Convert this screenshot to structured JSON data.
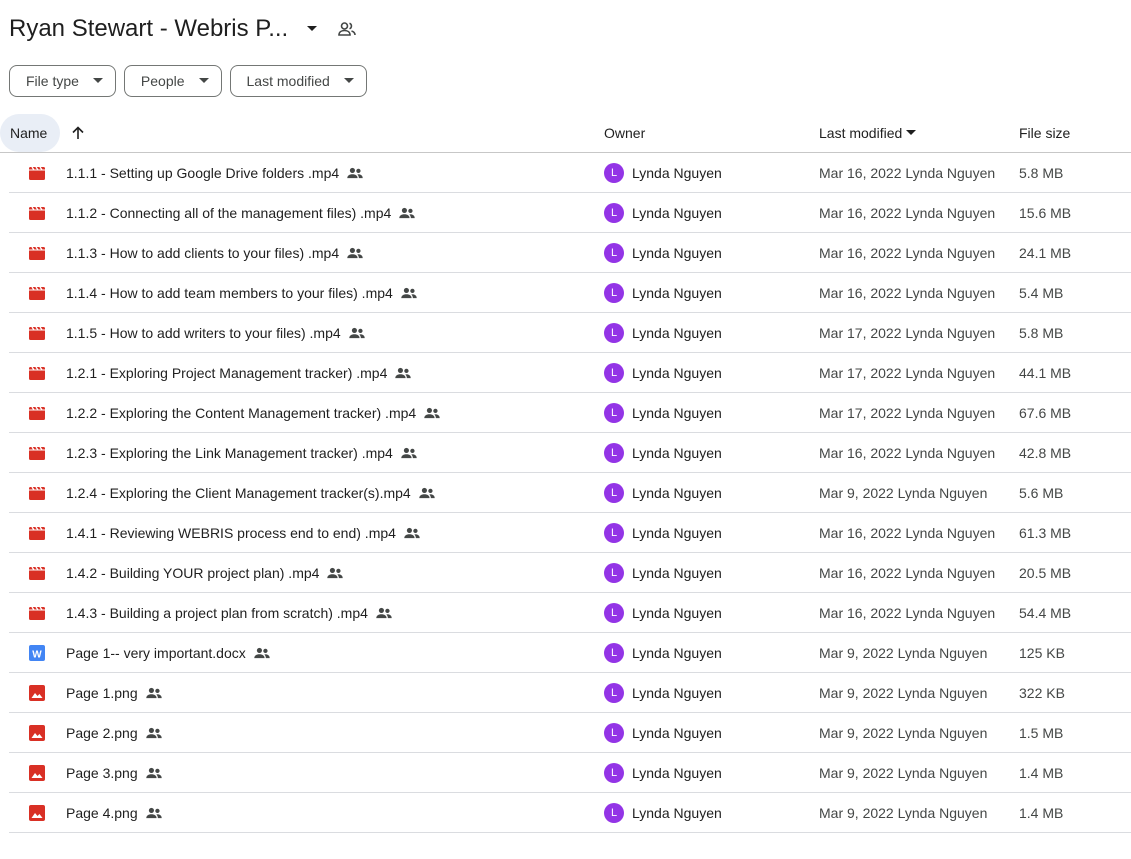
{
  "header": {
    "title": "Ryan Stewart - Webris P..."
  },
  "filters": [
    {
      "label": "File type"
    },
    {
      "label": "People"
    },
    {
      "label": "Last modified"
    }
  ],
  "columns": {
    "name": "Name",
    "owner": "Owner",
    "modified": "Last modified",
    "size": "File size"
  },
  "colors": {
    "video": "#d93025",
    "image": "#d93025",
    "doc": "#4285f4",
    "avatar": "#9334e6"
  },
  "files": [
    {
      "name": "1.1.1 - Setting up Google Drive folders .mp4",
      "type": "video",
      "owner": "Lynda Nguyen",
      "owner_initial": "L",
      "modified": "Mar 16, 2022 Lynda Nguyen",
      "size": "5.8 MB"
    },
    {
      "name": "1.1.2 - Connecting all of the management files) .mp4",
      "type": "video",
      "owner": "Lynda Nguyen",
      "owner_initial": "L",
      "modified": "Mar 16, 2022 Lynda Nguyen",
      "size": "15.6 MB"
    },
    {
      "name": "1.1.3 - How to add clients to your files) .mp4",
      "type": "video",
      "owner": "Lynda Nguyen",
      "owner_initial": "L",
      "modified": "Mar 16, 2022 Lynda Nguyen",
      "size": "24.1 MB"
    },
    {
      "name": "1.1.4 - How to add team members to your files) .mp4",
      "type": "video",
      "owner": "Lynda Nguyen",
      "owner_initial": "L",
      "modified": "Mar 16, 2022 Lynda Nguyen",
      "size": "5.4 MB"
    },
    {
      "name": "1.1.5 - How to add writers to your files) .mp4",
      "type": "video",
      "owner": "Lynda Nguyen",
      "owner_initial": "L",
      "modified": "Mar 17, 2022 Lynda Nguyen",
      "size": "5.8 MB"
    },
    {
      "name": "1.2.1 - Exploring Project Management tracker) .mp4",
      "type": "video",
      "owner": "Lynda Nguyen",
      "owner_initial": "L",
      "modified": "Mar 17, 2022 Lynda Nguyen",
      "size": "44.1 MB"
    },
    {
      "name": "1.2.2 - Exploring the Content Management tracker) .mp4",
      "type": "video",
      "owner": "Lynda Nguyen",
      "owner_initial": "L",
      "modified": "Mar 17, 2022 Lynda Nguyen",
      "size": "67.6 MB"
    },
    {
      "name": "1.2.3 - Exploring the Link Management tracker) .mp4",
      "type": "video",
      "owner": "Lynda Nguyen",
      "owner_initial": "L",
      "modified": "Mar 16, 2022 Lynda Nguyen",
      "size": "42.8 MB"
    },
    {
      "name": "1.2.4 - Exploring the Client Management tracker(s).mp4",
      "type": "video",
      "owner": "Lynda Nguyen",
      "owner_initial": "L",
      "modified": "Mar 9, 2022 Lynda Nguyen",
      "size": "5.6 MB"
    },
    {
      "name": "1.4.1 - Reviewing WEBRIS process end to end) .mp4",
      "type": "video",
      "owner": "Lynda Nguyen",
      "owner_initial": "L",
      "modified": "Mar 16, 2022 Lynda Nguyen",
      "size": "61.3 MB"
    },
    {
      "name": "1.4.2 - Building YOUR project plan) .mp4",
      "type": "video",
      "owner": "Lynda Nguyen",
      "owner_initial": "L",
      "modified": "Mar 16, 2022 Lynda Nguyen",
      "size": "20.5 MB"
    },
    {
      "name": "1.4.3 - Building a project plan from scratch) .mp4",
      "type": "video",
      "owner": "Lynda Nguyen",
      "owner_initial": "L",
      "modified": "Mar 16, 2022 Lynda Nguyen",
      "size": "54.4 MB"
    },
    {
      "name": "Page 1-- very important.docx",
      "type": "doc",
      "owner": "Lynda Nguyen",
      "owner_initial": "L",
      "modified": "Mar 9, 2022 Lynda Nguyen",
      "size": "125 KB"
    },
    {
      "name": "Page 1.png",
      "type": "image",
      "owner": "Lynda Nguyen",
      "owner_initial": "L",
      "modified": "Mar 9, 2022 Lynda Nguyen",
      "size": "322 KB"
    },
    {
      "name": "Page 2.png",
      "type": "image",
      "owner": "Lynda Nguyen",
      "owner_initial": "L",
      "modified": "Mar 9, 2022 Lynda Nguyen",
      "size": "1.5 MB"
    },
    {
      "name": "Page 3.png",
      "type": "image",
      "owner": "Lynda Nguyen",
      "owner_initial": "L",
      "modified": "Mar 9, 2022 Lynda Nguyen",
      "size": "1.4 MB"
    },
    {
      "name": "Page 4.png",
      "type": "image",
      "owner": "Lynda Nguyen",
      "owner_initial": "L",
      "modified": "Mar 9, 2022 Lynda Nguyen",
      "size": "1.4 MB"
    }
  ]
}
